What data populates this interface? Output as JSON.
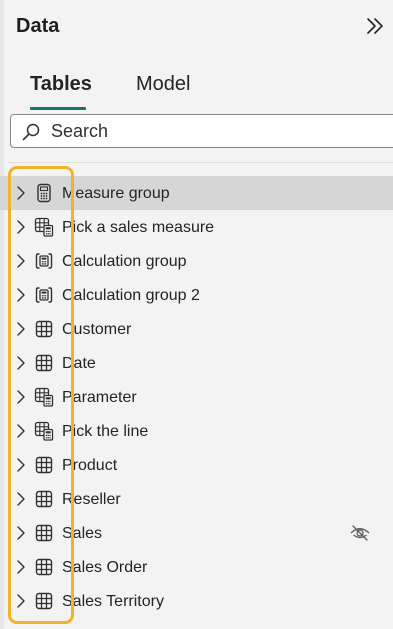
{
  "pane": {
    "title": "Data",
    "collapse_icon": "double-chevron-right-icon"
  },
  "tabs": [
    {
      "label": "Tables",
      "active": true
    },
    {
      "label": "Model",
      "active": false
    }
  ],
  "search": {
    "placeholder": "Search",
    "value": ""
  },
  "tables": [
    {
      "name": "Measure group",
      "icon": "calculator-icon",
      "selected": true,
      "hidden": false
    },
    {
      "name": "Pick a sales measure",
      "icon": "parameter-table-icon",
      "selected": false,
      "hidden": false
    },
    {
      "name": "Calculation group",
      "icon": "calculation-group-icon",
      "selected": false,
      "hidden": false
    },
    {
      "name": "Calculation group 2",
      "icon": "calculation-group-icon",
      "selected": false,
      "hidden": false
    },
    {
      "name": "Customer",
      "icon": "table-icon",
      "selected": false,
      "hidden": false
    },
    {
      "name": "Date",
      "icon": "table-icon",
      "selected": false,
      "hidden": false
    },
    {
      "name": "Parameter",
      "icon": "parameter-table-icon",
      "selected": false,
      "hidden": false
    },
    {
      "name": "Pick the line",
      "icon": "parameter-table-icon",
      "selected": false,
      "hidden": false
    },
    {
      "name": "Product",
      "icon": "table-icon",
      "selected": false,
      "hidden": false
    },
    {
      "name": "Reseller",
      "icon": "table-icon",
      "selected": false,
      "hidden": false
    },
    {
      "name": "Sales",
      "icon": "table-icon",
      "selected": false,
      "hidden": true
    },
    {
      "name": "Sales Order",
      "icon": "table-icon",
      "selected": false,
      "hidden": false
    },
    {
      "name": "Sales Territory",
      "icon": "table-icon",
      "selected": false,
      "hidden": false
    }
  ],
  "colors": {
    "accent_underline": "#117865",
    "highlight_box": "#f0b429",
    "selected_row": "#d6d6d6"
  }
}
